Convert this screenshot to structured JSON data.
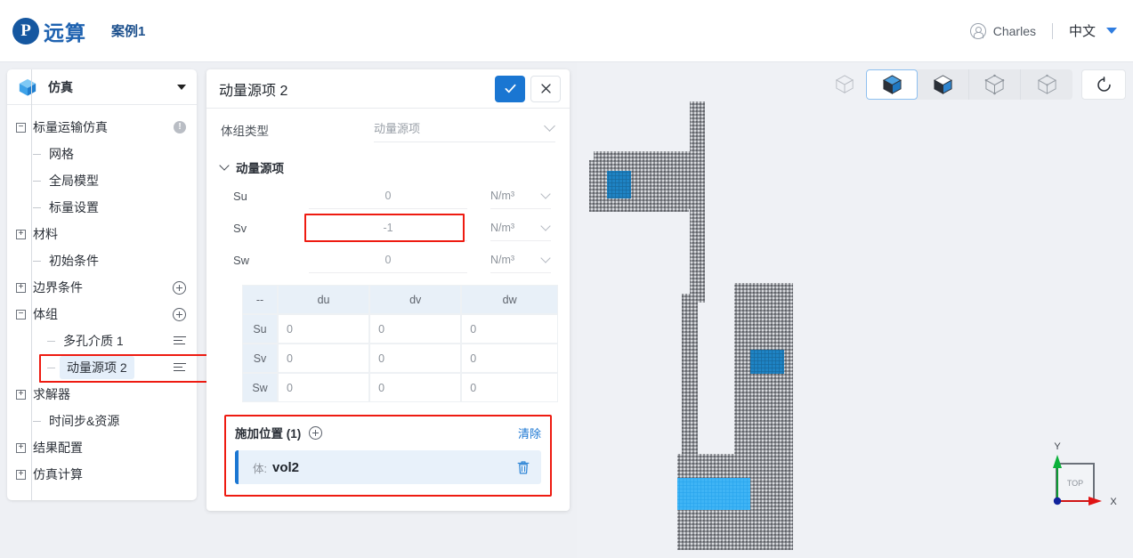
{
  "header": {
    "logo_text": "远算",
    "logo_icon": "paratera-logo-icon",
    "case_title": "案例1",
    "user_name": "Charles",
    "user_icon": "user-avatar-icon",
    "language": "中文",
    "lang_caret_icon": "chevron-down-icon"
  },
  "sidebar": {
    "header": {
      "icon": "blue-cube-icon",
      "label": "仿真",
      "caret_icon": "caret-down-icon"
    },
    "tree": [
      {
        "label": "标量运输仿真",
        "expander": "−",
        "depth": 0,
        "right_icon": "warning-icon",
        "selected": false
      },
      {
        "label": "网格",
        "expander": "stub",
        "depth": 1,
        "right_icon": "",
        "selected": false
      },
      {
        "label": "全局模型",
        "expander": "stub",
        "depth": 1,
        "right_icon": "",
        "selected": false
      },
      {
        "label": "标量设置",
        "expander": "stub",
        "depth": 1,
        "right_icon": "",
        "selected": false
      },
      {
        "label": "材料",
        "expander": "+",
        "depth": 0,
        "right_icon": "",
        "selected": false
      },
      {
        "label": "初始条件",
        "expander": "stub",
        "depth": 1,
        "right_icon": "",
        "selected": false
      },
      {
        "label": "边界条件",
        "expander": "+",
        "depth": 0,
        "right_icon": "plus-circle-icon",
        "selected": false
      },
      {
        "label": "体组",
        "expander": "−",
        "depth": 0,
        "right_icon": "plus-circle-icon",
        "selected": false
      },
      {
        "label": "多孔介质 1",
        "expander": "stub",
        "depth": 2,
        "right_icon": "list-icon",
        "selected": false
      },
      {
        "label": "动量源项 2",
        "expander": "stub",
        "depth": 2,
        "right_icon": "list-icon",
        "selected": true
      },
      {
        "label": "求解器",
        "expander": "+",
        "depth": 0,
        "right_icon": "",
        "selected": false
      },
      {
        "label": "时间步&资源",
        "expander": "stub",
        "depth": 1,
        "right_icon": "",
        "selected": false
      },
      {
        "label": "结果配置",
        "expander": "+",
        "depth": 0,
        "right_icon": "",
        "selected": false
      },
      {
        "label": "仿真计算",
        "expander": "+",
        "depth": 0,
        "right_icon": "",
        "selected": false
      }
    ]
  },
  "panel": {
    "title": "动量源项 2",
    "confirm_icon": "check-icon",
    "close_icon": "close-icon",
    "type_label": "体组类型",
    "type_value": "动量源项",
    "type_caret_icon": "chevron-down-icon",
    "group_title": "动量源项",
    "group_caret_icon": "chevron-down-icon",
    "fields": [
      {
        "name": "Su",
        "value": "0",
        "unit": "N/m³",
        "highlighted": false
      },
      {
        "name": "Sv",
        "value": "-1",
        "unit": "N/m³",
        "highlighted": true
      },
      {
        "name": "Sw",
        "value": "0",
        "unit": "N/m³",
        "highlighted": false
      }
    ],
    "matrix": {
      "corner": "--",
      "columns": [
        "du",
        "dv",
        "dw"
      ],
      "rows": [
        {
          "name": "Su",
          "values": [
            "0",
            "0",
            "0"
          ]
        },
        {
          "name": "Sv",
          "values": [
            "0",
            "0",
            "0"
          ]
        },
        {
          "name": "Sw",
          "values": [
            "0",
            "0",
            "0"
          ]
        }
      ]
    },
    "apply": {
      "title": "施加位置 (1)",
      "add_icon": "plus-circle-icon",
      "clear_label": "清除",
      "items": [
        {
          "kind": "体:",
          "name": "vol2",
          "delete_icon": "trash-icon"
        }
      ]
    }
  },
  "viewport": {
    "toolbar": [
      {
        "icon": "wireframe-cube-icon",
        "active": false,
        "ghost": true
      },
      {
        "icon": "solid-shaded-cube-icon",
        "active": true,
        "ghost": false
      },
      {
        "icon": "half-shaded-cube-icon",
        "active": false,
        "ghost": false
      },
      {
        "icon": "outline-cube-icon",
        "active": false,
        "ghost": false
      },
      {
        "icon": "transparent-cube-icon",
        "active": false,
        "ghost": false
      },
      {
        "icon": "reload-icon",
        "active": false,
        "ghost": false
      }
    ],
    "triad": {
      "x_label": "X",
      "y_label": "Y",
      "face_label": "TOP"
    }
  },
  "colors": {
    "accent_blue": "#1a76d2",
    "highlight_red": "#ee1b11",
    "selected_region_blue": "#29a5ee",
    "secondary_region_blue": "#1a7bb8",
    "logo_blue": "#1e62b0",
    "panel_bg": "#ffffff",
    "app_bg": "#eef0f4"
  }
}
